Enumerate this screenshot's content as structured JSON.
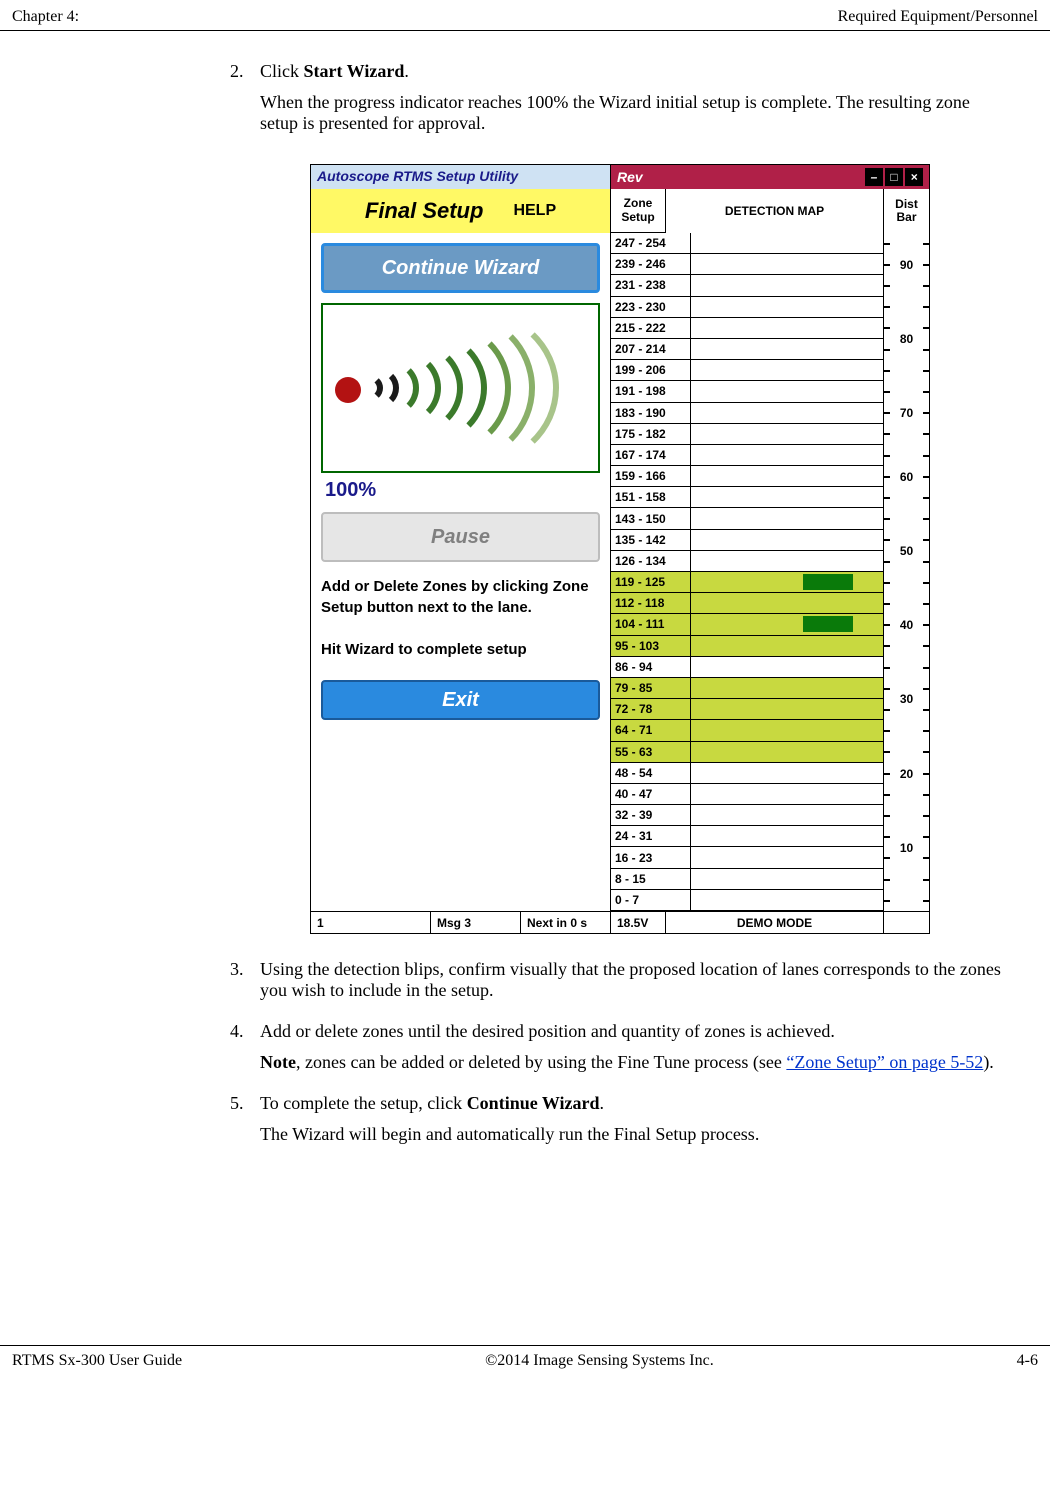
{
  "header": {
    "left": "Chapter 4:",
    "right": "Required Equipment/Personnel"
  },
  "steps": {
    "s2": {
      "num": "2.",
      "line1a": "Click ",
      "line1b": "Start Wizard",
      "line1c": ".",
      "para": "When the progress indicator reaches 100% the Wizard initial setup is complete. The resulting zone setup is presented for approval."
    },
    "s3": {
      "num": "3.",
      "text": "Using the detection blips, confirm visually that the proposed location of lanes corresponds to the zones you wish to include in the setup."
    },
    "s4": {
      "num": "4.",
      "text": "Add or delete zones until the desired position and quantity of zones is achieved.",
      "noteA": "Note",
      "noteB": ", zones can be added or deleted by using the Fine Tune process (see ",
      "link": "“Zone Setup” on page 5-52",
      "noteC": ")."
    },
    "s5": {
      "num": "5.",
      "line1a": "To complete the setup, click ",
      "line1b": "Continue Wizard",
      "line1c": ".",
      "para": "The Wizard will begin and automatically run the Final Setup process."
    }
  },
  "figure": {
    "title_left": "Autoscope RTMS Setup Utility",
    "title_right": "Rev",
    "win": {
      "min": "–",
      "max": "□",
      "close": "×"
    },
    "header": {
      "final_setup": "Final Setup",
      "help": "HELP",
      "zone": "Zone",
      "setup": "Setup",
      "det_map": "DETECTION MAP",
      "dist": "Dist",
      "bar": "Bar"
    },
    "left": {
      "continue": "Continue Wizard",
      "pct": "100%",
      "pause": "Pause",
      "instr1": "Add or Delete Zones by clicking Zone Setup button next to the lane.",
      "instr2": "Hit Wizard to complete setup",
      "exit": "Exit"
    },
    "zones": [
      {
        "r": "247 - 254",
        "hl": false,
        "blip": false
      },
      {
        "r": "239 - 246",
        "hl": false,
        "blip": false
      },
      {
        "r": "231 - 238",
        "hl": false,
        "blip": false
      },
      {
        "r": "223 - 230",
        "hl": false,
        "blip": false
      },
      {
        "r": "215 - 222",
        "hl": false,
        "blip": false
      },
      {
        "r": "207 - 214",
        "hl": false,
        "blip": false
      },
      {
        "r": "199 - 206",
        "hl": false,
        "blip": false
      },
      {
        "r": "191 - 198",
        "hl": false,
        "blip": false
      },
      {
        "r": "183 - 190",
        "hl": false,
        "blip": false
      },
      {
        "r": "175 - 182",
        "hl": false,
        "blip": false
      },
      {
        "r": "167 - 174",
        "hl": false,
        "blip": false
      },
      {
        "r": "159 - 166",
        "hl": false,
        "blip": false
      },
      {
        "r": "151 - 158",
        "hl": false,
        "blip": false
      },
      {
        "r": "143 - 150",
        "hl": false,
        "blip": false
      },
      {
        "r": "135 - 142",
        "hl": false,
        "blip": false
      },
      {
        "r": "126 - 134",
        "hl": false,
        "blip": false
      },
      {
        "r": "119 - 125",
        "hl": true,
        "blip": true
      },
      {
        "r": "112 - 118",
        "hl": true,
        "blip": false
      },
      {
        "r": "104 - 111",
        "hl": true,
        "blip": true
      },
      {
        "r": "95 - 103",
        "hl": true,
        "blip": false
      },
      {
        "r": "86 - 94",
        "hl": false,
        "blip": false
      },
      {
        "r": "79 - 85",
        "hl": true,
        "blip": false
      },
      {
        "r": "72 - 78",
        "hl": true,
        "blip": false
      },
      {
        "r": "64 - 71",
        "hl": true,
        "blip": false
      },
      {
        "r": "55 - 63",
        "hl": true,
        "blip": false
      },
      {
        "r": "48 - 54",
        "hl": false,
        "blip": false
      },
      {
        "r": "40 - 47",
        "hl": false,
        "blip": false
      },
      {
        "r": "32 - 39",
        "hl": false,
        "blip": false
      },
      {
        "r": "24 - 31",
        "hl": false,
        "blip": false
      },
      {
        "r": "16 - 23",
        "hl": false,
        "blip": false
      },
      {
        "r": "8 - 15",
        "hl": false,
        "blip": false
      },
      {
        "r": "0 - 7",
        "hl": false,
        "blip": false
      }
    ],
    "dist_labels": [
      "90",
      "80",
      "70",
      "60",
      "50",
      "40",
      "30",
      "20",
      "10"
    ],
    "footer": {
      "f1": "1",
      "msg": "Msg 3",
      "next": "Next in 0 s",
      "volt": "18.5V",
      "demo": "DEMO MODE"
    }
  },
  "footer": {
    "left": "RTMS Sx-300 User Guide",
    "center": "©2014 Image Sensing Systems Inc.",
    "right": "4-6"
  }
}
